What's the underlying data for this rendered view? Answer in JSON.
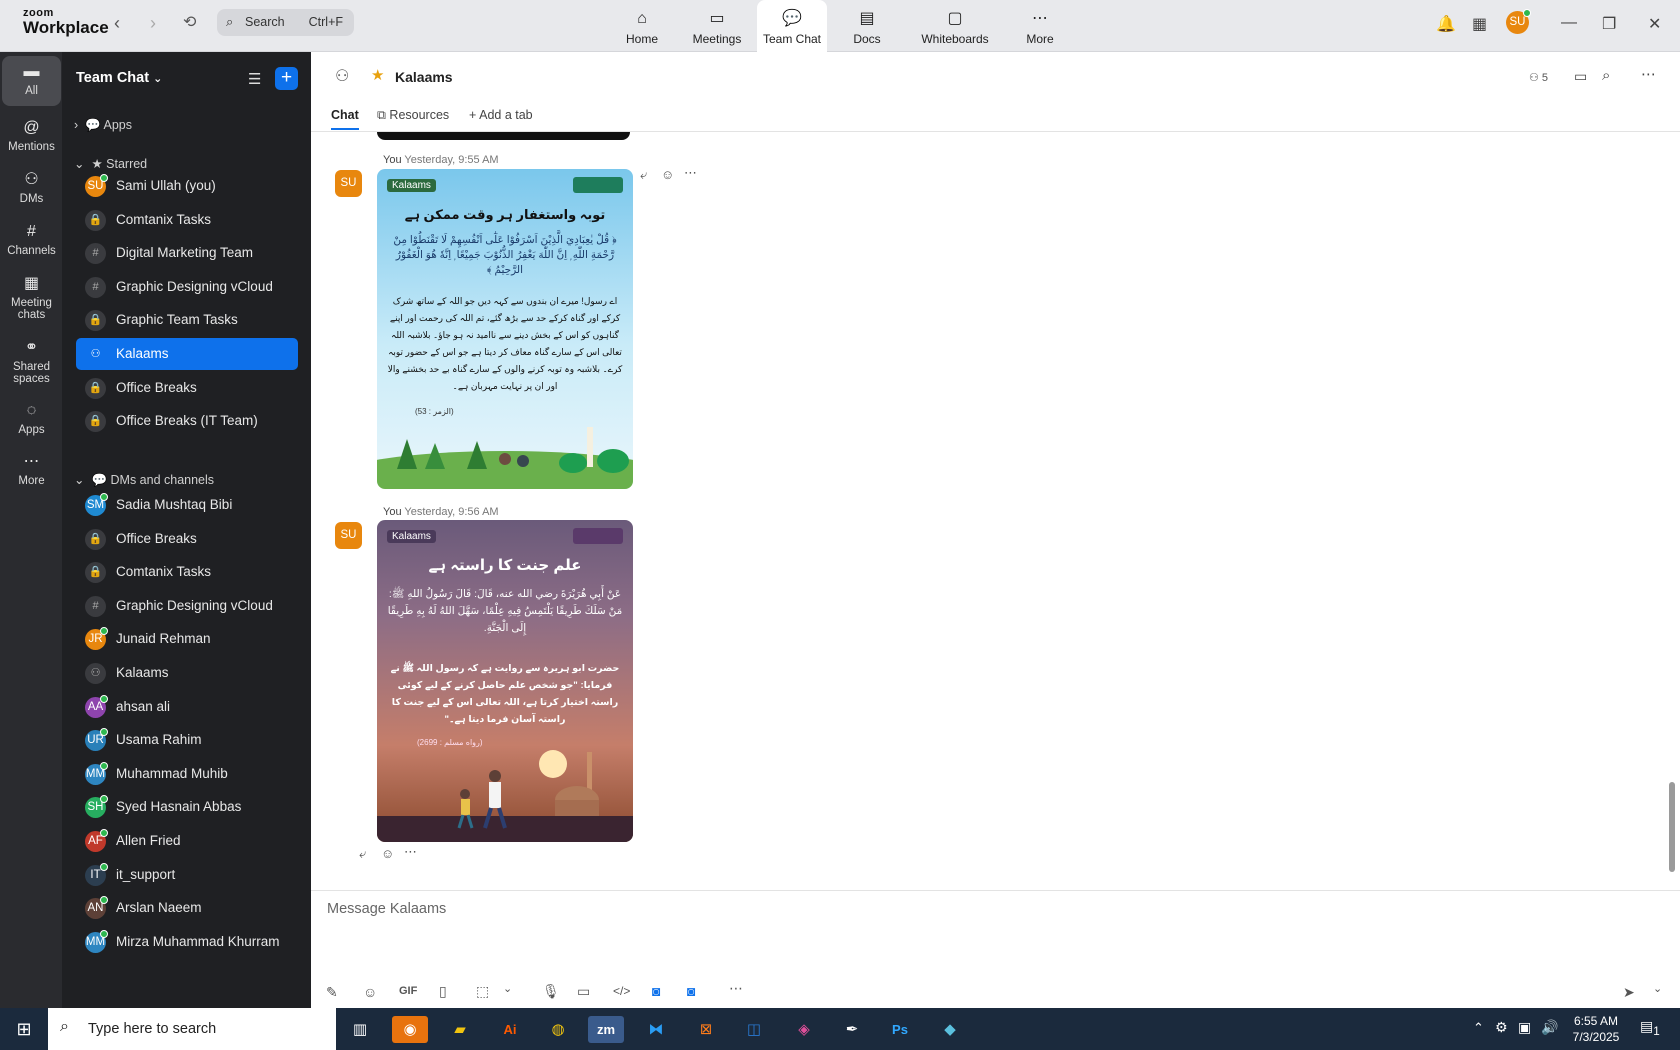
{
  "app": {
    "brand_top": "zoom",
    "brand_bottom": "Workplace",
    "search_placeholder": "Search",
    "search_shortcut": "Ctrl+F",
    "user_initials": "SU"
  },
  "topnav": [
    {
      "label": "Home",
      "icon": "home-icon"
    },
    {
      "label": "Meetings",
      "icon": "video-camera-icon"
    },
    {
      "label": "Team Chat",
      "icon": "chat-bubbles-icon"
    },
    {
      "label": "Docs",
      "icon": "document-icon"
    },
    {
      "label": "Whiteboards",
      "icon": "whiteboard-icon"
    },
    {
      "label": "More",
      "icon": "more-dots-icon"
    }
  ],
  "rail": [
    {
      "label": "All",
      "icon": "chat-icon"
    },
    {
      "label": "Mentions",
      "icon": "at-icon"
    },
    {
      "label": "DMs",
      "icon": "people-icon"
    },
    {
      "label": "Channels",
      "icon": "hash-icon"
    },
    {
      "label": "Meeting chats",
      "icon": "calendar-icon"
    },
    {
      "label": "Shared spaces",
      "icon": "share-icon"
    },
    {
      "label": "Apps",
      "icon": "apps-icon"
    },
    {
      "label": "More",
      "icon": "more-icon"
    }
  ],
  "sidebar": {
    "title": "Team Chat",
    "apps_label": "Apps",
    "starred_label": "Starred",
    "dms_label": "DMs and channels",
    "starred": [
      {
        "label": "Sami Ullah (you)",
        "type": "avatar",
        "initials": "SU",
        "color": "#e8870e"
      },
      {
        "label": "Comtanix Tasks",
        "type": "lock"
      },
      {
        "label": "Digital Marketing Team",
        "type": "hash"
      },
      {
        "label": "Graphic Designing vCloud",
        "type": "hash"
      },
      {
        "label": "Graphic Team Tasks",
        "type": "lock"
      },
      {
        "label": "Kalaams",
        "type": "group"
      },
      {
        "label": "Office Breaks",
        "type": "lock"
      },
      {
        "label": "Office Breaks (IT Team)",
        "type": "lock"
      }
    ],
    "dms": [
      {
        "label": "Sadia Mushtaq Bibi",
        "type": "avatar",
        "initials": "SM",
        "color": "#1f8ad2"
      },
      {
        "label": "Office Breaks",
        "type": "lock"
      },
      {
        "label": "Comtanix Tasks",
        "type": "lock"
      },
      {
        "label": "Graphic Designing vCloud",
        "type": "hash"
      },
      {
        "label": "Junaid Rehman",
        "type": "avatar",
        "initials": "JR",
        "color": "#e8870e"
      },
      {
        "label": "Kalaams",
        "type": "group"
      },
      {
        "label": "ahsan ali",
        "type": "avatar",
        "initials": "AA",
        "color": "#8e44ad"
      },
      {
        "label": "Usama Rahim",
        "type": "avatar",
        "initials": "UR",
        "color": "#2980b9"
      },
      {
        "label": "Muhammad Muhib",
        "type": "avatar",
        "initials": "MM",
        "color": "#2e86c1"
      },
      {
        "label": "Syed Hasnain Abbas",
        "type": "avatar",
        "initials": "SH",
        "color": "#27ae60"
      },
      {
        "label": "Allen Fried",
        "type": "avatar",
        "initials": "AF",
        "color": "#c0392b"
      },
      {
        "label": "it_support",
        "type": "avatar",
        "initials": "IT",
        "color": "#2c3e50"
      },
      {
        "label": "Arslan Naeem",
        "type": "avatar",
        "initials": "AN",
        "color": "#5d4037"
      },
      {
        "label": "Mirza Muhammad Khurram",
        "type": "avatar",
        "initials": "MM",
        "color": "#2e86c1"
      }
    ]
  },
  "chat": {
    "title": "Kalaams",
    "members": "5",
    "tabs": [
      "Chat",
      "Resources",
      "Add a tab"
    ],
    "messages": [
      {
        "sender": "You",
        "time": "Yesterday, 9:55 AM",
        "initials": "SU",
        "card": {
          "brand": "Kalaams",
          "heading": "توبہ واستغفار ہر وقت ممکن ہے",
          "arabic": "﴿ قُلْ يٰعِبَادِيَ الَّذِيْنَ اَسْرَفُوْا عَلٰٓى اَنْفُسِهِمْ لَا تَقْنَطُوْا مِنْ رَّحْمَةِ اللّٰهِ ۭ اِنَّ اللّٰهَ يَغْفِرُ الذُّنُوْبَ جَمِيْعًا ۭ اِنَّهٗ هُوَ الْغَفُوْرُ الرَّحِيْمُ ﴾",
          "urdu": "اے رسول! میرے ان بندوں سے کہہ دیں جو اللہ کے ساتھ شرک کرکے اور گناہ کرکے حد سے بڑھ گئے، تم اللہ کی رحمت اور اپنے گناہوں کو اس کے بخش دینے سے ناامید نہ ہو جاؤ۔ بلاشبہ اللہ تعالی اس کے سارے گناہ معاف کر دیتا ہے جو اس کے حضور توبہ کرے۔ بلاشبہ وہ توبہ کرنے والوں کے سارے گناہ بے حد بخشنے والا اور ان پر نہایت مہربان ہے۔",
          "ref": "(الزمر : 53)"
        }
      },
      {
        "sender": "You",
        "time": "Yesterday, 9:56 AM",
        "initials": "SU",
        "card": {
          "brand": "Kalaams",
          "heading": "علم جنت کا راستہ ہے",
          "arabic": "عَنْ أَبِي هُرَيْرَةَ رضي الله عنه، قَالَ: قَالَ رَسُولُ اللهِ ﷺ: مَنْ سَلَكَ طَرِيقًا يَلْتَمِسُ فِيهِ عِلْمًا، سَهَّلَ اللهُ لَهُ بِهِ طَرِيقًا إِلَى الْجَنَّةِ.",
          "urdu": "حضرت ابو ہریرہ سے روایت ہے کہ رسول اللہ ﷺ نے فرمایا: \"جو شخص علم حاصل کرنے کے لیے کوئی راستہ اختیار کرتا ہے، اللہ تعالی اس کے لیے جنت کا راستہ آسان فرما دیتا ہے۔\"",
          "ref": "(رواه مسلم : 2699)"
        }
      }
    ],
    "composer_placeholder": "Message Kalaams"
  },
  "taskbar": {
    "search_placeholder": "Type here to search",
    "time": "6:55 AM",
    "date": "7/3/2025",
    "notif": "1"
  }
}
